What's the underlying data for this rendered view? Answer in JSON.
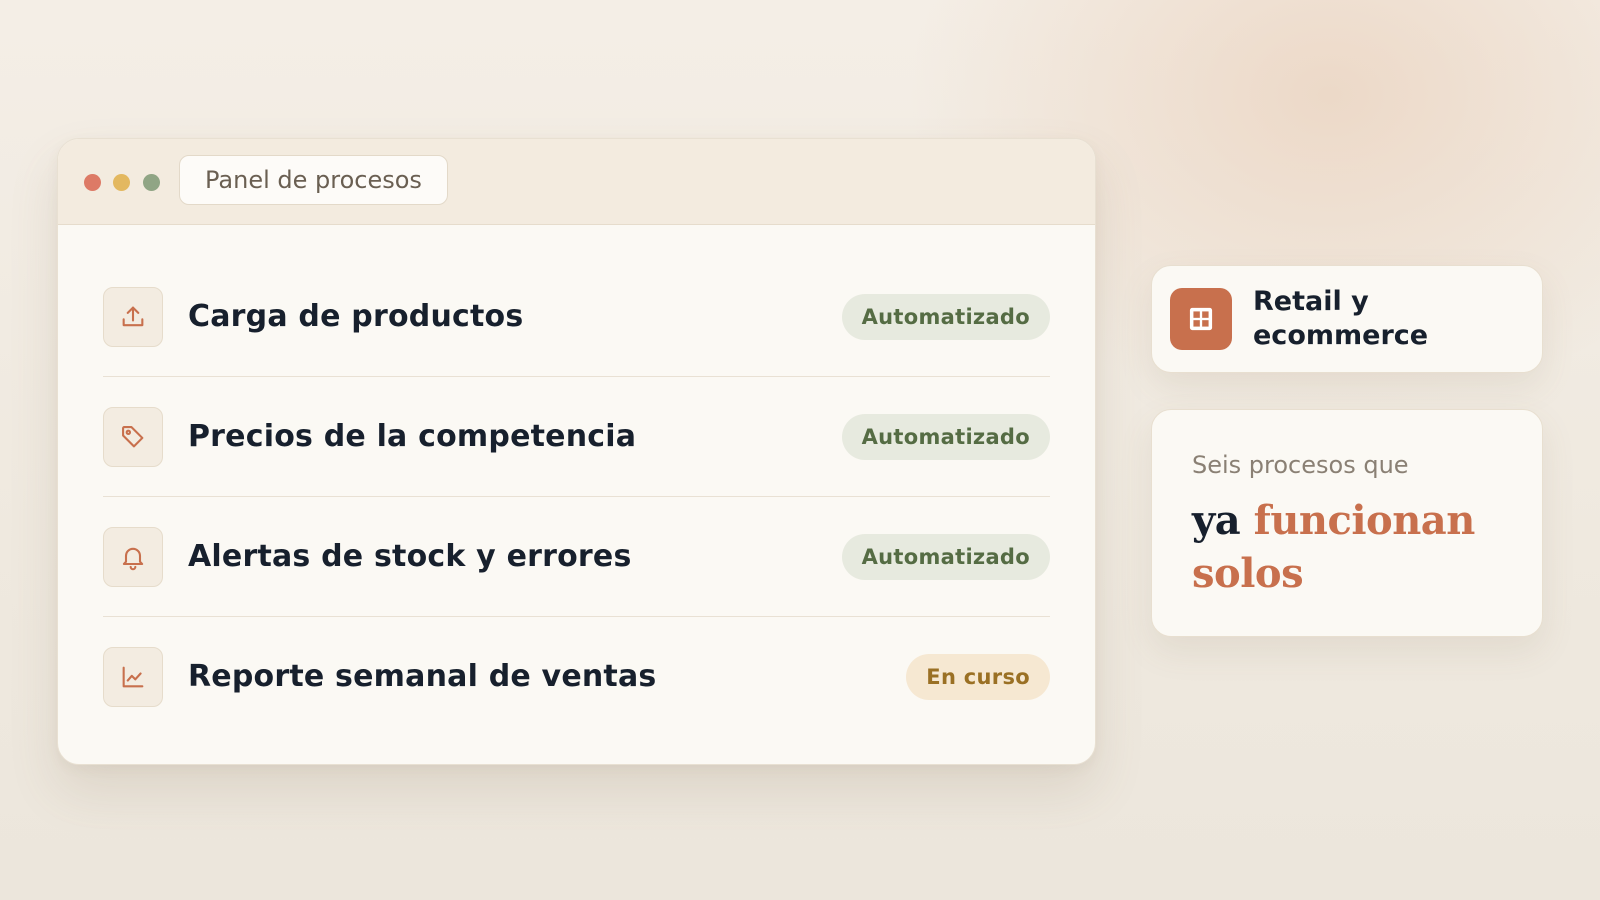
{
  "window": {
    "title": "Panel de procesos",
    "controls": [
      "close",
      "minimize",
      "maximize"
    ]
  },
  "processes": [
    {
      "label": "Carga de productos",
      "icon": "upload-icon",
      "status": "Automatizado",
      "status_type": "done"
    },
    {
      "label": "Precios de la competencia",
      "icon": "tag-icon",
      "status": "Automatizado",
      "status_type": "done"
    },
    {
      "label": "Alertas de stock y errores",
      "icon": "bell-icon",
      "status": "Automatizado",
      "status_type": "done"
    },
    {
      "label": "Reporte semanal de ventas",
      "icon": "line-chart-icon",
      "status": "En curso",
      "status_type": "progress"
    }
  ],
  "industry": {
    "label": "Retail y ecommerce",
    "icon": "grid-icon"
  },
  "headline": {
    "eyebrow": "Seis procesos que",
    "lead": "ya",
    "accent": "funcionan solos"
  },
  "colors": {
    "accent": "#c8704d",
    "text": "#17202d",
    "automated_badge_bg": "#e7eadf",
    "automated_badge_text": "#556c44",
    "progress_badge_bg": "#f6e8d2",
    "progress_badge_text": "#9a7024"
  }
}
